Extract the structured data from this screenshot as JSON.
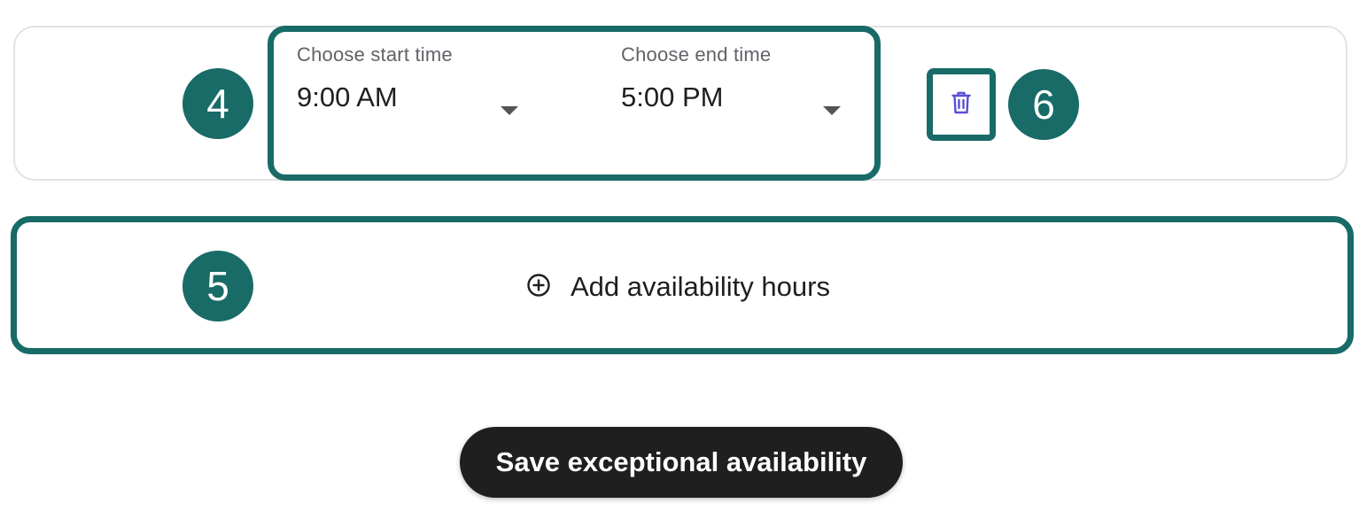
{
  "time_range": {
    "start": {
      "label": "Choose start time",
      "value": "9:00 AM"
    },
    "end": {
      "label": "Choose end time",
      "value": "5:00 PM"
    }
  },
  "delete_button": {
    "icon": "trash-icon",
    "icon_color": "#5b4fd6"
  },
  "add_hours": {
    "icon": "plus-circle-icon",
    "label": "Add availability hours"
  },
  "save_button": {
    "label": "Save exceptional availability"
  },
  "callouts": {
    "badge_4": "4",
    "badge_5": "5",
    "badge_6": "6"
  },
  "colors": {
    "accent": "#186b67",
    "button_dark": "#1f1f1f"
  }
}
